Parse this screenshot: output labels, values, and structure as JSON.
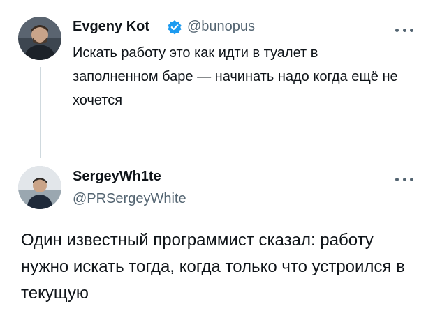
{
  "tweet1": {
    "name": "Evgeny Kot",
    "handle": "@bunopus",
    "text": "Искать работу это как идти в туалет в заполненном баре — начинать надо когда ещё не хочется",
    "verified_icon": "verified-badge-icon",
    "more_icon": "more-options-icon"
  },
  "tweet2": {
    "name": "SergeyWh1te",
    "handle": "@PRSergeyWhite",
    "text": "Один известный программист сказал: работу нужно искать тогда, когда только что устроился в текущую",
    "more_icon": "more-options-icon"
  },
  "colors": {
    "verified": "#1d9bf0",
    "handle": "#536471",
    "thread_line": "#cfd9de"
  }
}
